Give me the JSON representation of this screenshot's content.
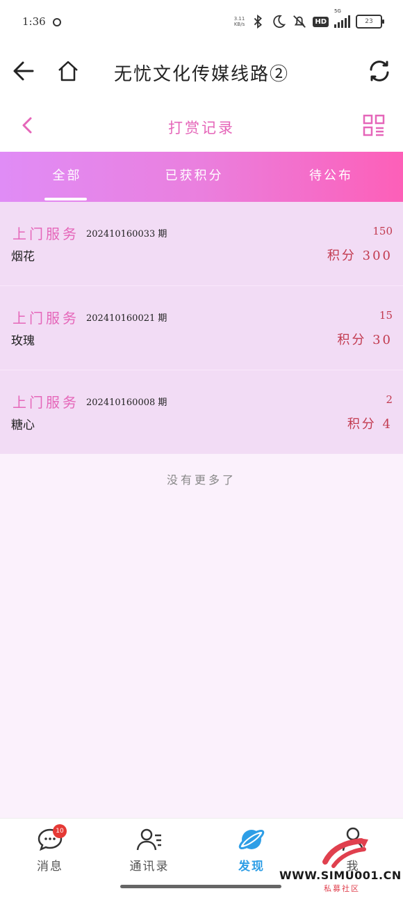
{
  "status": {
    "time": "1:36",
    "net_speed_value": "3.11",
    "net_speed_unit": "KB/s",
    "hd": "HD",
    "network": "5G",
    "battery": "23"
  },
  "header": {
    "title": "无忧文化传媒线路②",
    "back_icon": "arrow-left-icon",
    "home_icon": "home-icon",
    "refresh_icon": "refresh-icon"
  },
  "subheader": {
    "title": "打赏记录",
    "back_icon": "chevron-left-icon",
    "menu_icon": "grid-menu-icon"
  },
  "tabs": [
    {
      "label": "全部",
      "active": true
    },
    {
      "label": "已获积分",
      "active": false
    },
    {
      "label": "待公布",
      "active": false
    }
  ],
  "records": [
    {
      "type": "上门服务",
      "period": "202410160033 期",
      "count": "150",
      "gift": "烟花",
      "points": "积分 300"
    },
    {
      "type": "上门服务",
      "period": "202410160021 期",
      "count": "15",
      "gift": "玫瑰",
      "points": "积分 30"
    },
    {
      "type": "上门服务",
      "period": "202410160008 期",
      "count": "2",
      "gift": "糖心",
      "points": "积分 4"
    }
  ],
  "no_more": "没有更多了",
  "bottom_nav": [
    {
      "label": "消息",
      "icon": "chat-bubble-icon",
      "badge": "10",
      "active": false
    },
    {
      "label": "通讯录",
      "icon": "contacts-icon",
      "active": false
    },
    {
      "label": "发现",
      "icon": "discover-planet-icon",
      "active": true
    },
    {
      "label": "我",
      "icon": "profile-icon",
      "active": false
    }
  ],
  "watermark": {
    "text": "WWW.SIMU001.CN",
    "sub": "私募社区"
  },
  "colors": {
    "accent": "#e566b9",
    "tab_gradient_start": "#e08cf6",
    "tab_gradient_end": "#fd5fb8",
    "points": "#c23a4f",
    "active_nav": "#2e9ee6"
  }
}
